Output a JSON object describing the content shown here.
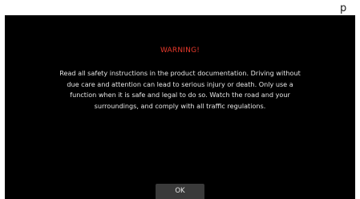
{
  "dialog": {
    "title": "WARNING!",
    "message": "Read all safety instructions in the product documentation. Driving without due care and attention can lead to serious injury or death. Only use a function when it is safe and legal to do so. Watch the road and your surroundings, and comply with all traffic regulations.",
    "ok_label": "OK"
  },
  "colors": {
    "background": "#000000",
    "title": "#e8392b",
    "text": "#e6e6e6",
    "button": "#3a3a3a"
  }
}
